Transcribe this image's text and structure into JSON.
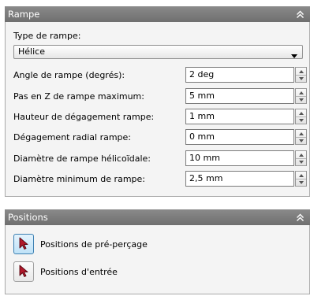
{
  "rampe_panel": {
    "title": "Rampe",
    "type_label": "Type de rampe:",
    "type_value": "Hélice",
    "rows": [
      {
        "label": "Angle de rampe (degrés):",
        "value": "2 deg"
      },
      {
        "label": "Pas en Z de rampe maximum:",
        "value": "5 mm"
      },
      {
        "label": "Hauteur de dégagement rampe:",
        "value": "1 mm"
      },
      {
        "label": "Dégagement radial rampe:",
        "value": "0 mm"
      },
      {
        "label": "Diamètre de rampe hélicoïdale:",
        "value": "10 mm"
      },
      {
        "label": "Diamètre minimum de rampe:",
        "value": "2,5 mm"
      }
    ]
  },
  "positions_panel": {
    "title": "Positions",
    "items": [
      {
        "label": "Positions de pré-perçage",
        "icon": "cursor-arrow-icon",
        "active": true
      },
      {
        "label": "Positions d'entrée",
        "icon": "cursor-arrow-icon",
        "active": false
      }
    ]
  },
  "colors": {
    "header": "#7c7c7c",
    "body": "#f4f4f4",
    "icon_red": "#b0182a"
  }
}
